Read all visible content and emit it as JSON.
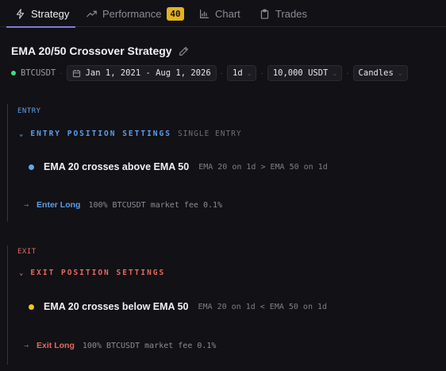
{
  "tabs": {
    "strategy": "Strategy",
    "performance": "Performance",
    "performance_badge": "40",
    "chart": "Chart",
    "trades": "Trades"
  },
  "strategy": {
    "title": "EMA 20/50 Crossover Strategy"
  },
  "toolbar": {
    "symbol": "BTCUSDT",
    "date_range": "Jan 1, 2021 - Aug 1, 2026",
    "interval": "1d",
    "capital": "10,000 USDT",
    "chart_type": "Candles"
  },
  "entry": {
    "label": "ENTRY",
    "settings_title": "ENTRY POSITION SETTINGS",
    "settings_sub": "SINGLE ENTRY",
    "condition_title": "EMA 20 crosses above EMA 50",
    "condition_detail": "EMA 20 on 1d > EMA 50 on 1d",
    "action_name": "Enter Long",
    "action_detail": "100% BTCUSDT market fee 0.1%"
  },
  "exit": {
    "label": "EXIT",
    "settings_title": "EXIT POSITION SETTINGS",
    "condition_title": "EMA 20 crosses below EMA 50",
    "condition_detail": "EMA 20 on 1d < EMA 50 on 1d",
    "action_name": "Exit Long",
    "action_detail": "100% BTCUSDT market fee 0.1%"
  },
  "colors": {
    "accent": "#7d7dd6",
    "entry": "#5b9ee8",
    "exit": "#e46a5e",
    "badge": "#e2b224",
    "status_dot": "#3ddc84",
    "entry_dot": "#5aa9f0",
    "exit_dot": "#f5c518"
  }
}
